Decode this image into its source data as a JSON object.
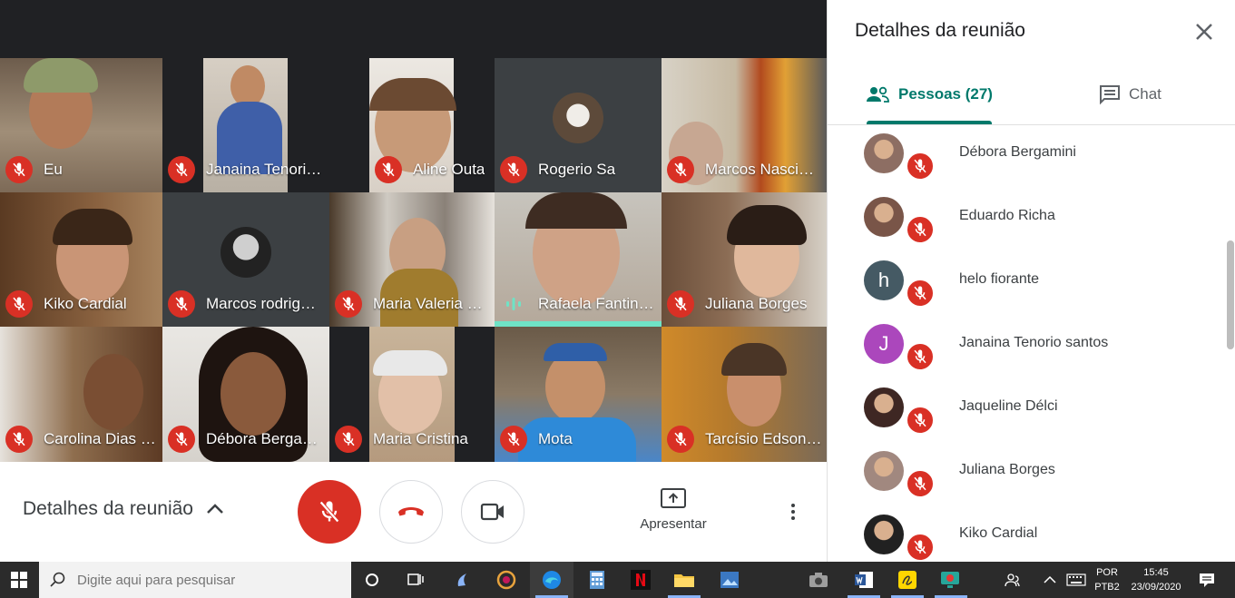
{
  "participants_grid": [
    {
      "name": "Eu",
      "status": "muted"
    },
    {
      "name": "Janaina Tenori…",
      "status": "muted"
    },
    {
      "name": "Aline Outa",
      "status": "muted"
    },
    {
      "name": "Rogerio Sa",
      "status": "muted"
    },
    {
      "name": "Marcos Nasci…",
      "status": "muted"
    },
    {
      "name": "Kiko Cardial",
      "status": "muted"
    },
    {
      "name": "Marcos rodrig…",
      "status": "muted"
    },
    {
      "name": "Maria Valeria …",
      "status": "muted"
    },
    {
      "name": "Rafaela Fantin…",
      "status": "speaking"
    },
    {
      "name": "Juliana Borges",
      "status": "muted"
    },
    {
      "name": "Carolina Dias F…",
      "status": "muted"
    },
    {
      "name": "Débora Berga…",
      "status": "muted"
    },
    {
      "name": "Maria Cristina",
      "status": "muted"
    },
    {
      "name": "Mota",
      "status": "muted"
    },
    {
      "name": "Tarcísio Edson…",
      "status": "muted"
    }
  ],
  "controls": {
    "details_label": "Detalhes da reunião",
    "present_label": "Apresentar"
  },
  "panel": {
    "title": "Detalhes da reunião",
    "tab_people": "Pessoas (27)",
    "tab_chat": "Chat",
    "people": [
      {
        "name": "Débora Bergamini",
        "initial": "",
        "color": "#8d6e63"
      },
      {
        "name": "Eduardo Richa",
        "initial": "",
        "color": "#795548"
      },
      {
        "name": "helo fiorante",
        "initial": "h",
        "color": "#455a64"
      },
      {
        "name": "Janaina Tenorio santos",
        "initial": "J",
        "color": "#ab47bc"
      },
      {
        "name": "Jaqueline Délci",
        "initial": "",
        "color": "#3e2723"
      },
      {
        "name": "Juliana Borges",
        "initial": "",
        "color": "#a1887f"
      },
      {
        "name": "Kiko Cardial",
        "initial": "",
        "color": "#212121"
      }
    ]
  },
  "taskbar": {
    "search_placeholder": "Digite aqui para pesquisar",
    "lang_top": "POR",
    "lang_bottom": "PTB2",
    "time": "15:45",
    "date": "23/09/2020"
  },
  "colors": {
    "mic_off": "#d93025",
    "accent": "#00796b",
    "speaking": "#6fe3c6"
  }
}
